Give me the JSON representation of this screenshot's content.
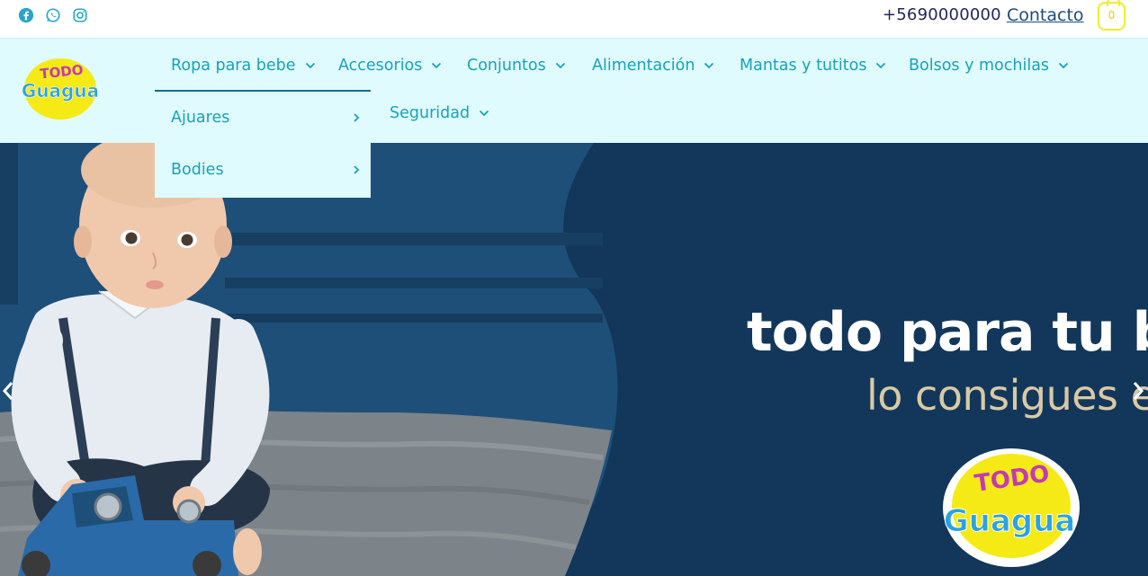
{
  "topbar": {
    "social_icons": [
      "facebook-icon",
      "whatsapp-icon",
      "instagram-icon"
    ],
    "phone": "+5690000000",
    "contact_label": "Contacto",
    "cart_count": "0"
  },
  "brand": {
    "logo_line1": "TODO",
    "logo_line2": "Guagua"
  },
  "nav": {
    "items": [
      {
        "label": "Ropa para bebe"
      },
      {
        "label": "Accesorios"
      },
      {
        "label": "Conjuntos"
      },
      {
        "label": "Alimentación"
      },
      {
        "label": "Mantas y tutitos"
      },
      {
        "label": "Bolsos y mochilas"
      },
      {
        "label": "Seguridad"
      }
    ],
    "dropdown": [
      {
        "label": "Ajuares"
      },
      {
        "label": "Bodies"
      }
    ]
  },
  "hero": {
    "slogan_line1": "todo para tu be",
    "slogan_line2": "lo consigues en",
    "logo_line1": "TODO",
    "logo_line2": "Guagua"
  },
  "colors": {
    "accent": "#17a2b8",
    "header_bg": "#e0fbfd",
    "hero_bg": "#12375a",
    "brand_yellow": "#f5ea16",
    "brand_purple": "#c33ab4",
    "brand_blue": "#2aa3e0"
  }
}
